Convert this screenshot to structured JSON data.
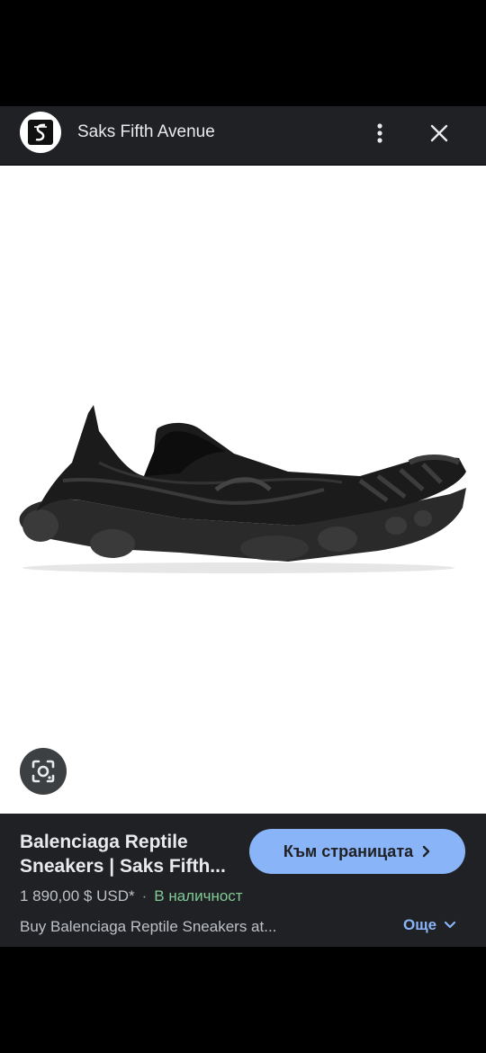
{
  "header": {
    "site_name": "Saks Fifth Avenue",
    "logo_icon": "saks-logo-icon",
    "menu_icon": "more-vert-icon",
    "close_icon": "close-icon"
  },
  "image": {
    "subject": "black sneaker",
    "lens_icon": "google-lens-icon"
  },
  "product": {
    "title_line1": "Balenciaga Reptile",
    "title_line2": "Sneakers | Saks Fifth...",
    "visit_label": "Към страницата",
    "price": "1 890,00 $ USD*",
    "separator": "·",
    "availability": "В наличност",
    "description": "Buy Balenciaga Reptile Sneakers at...",
    "more_label": "Още"
  },
  "colors": {
    "panel_bg": "#202124",
    "accent_blue": "#8ab4f8",
    "in_stock_green": "#81c995"
  }
}
